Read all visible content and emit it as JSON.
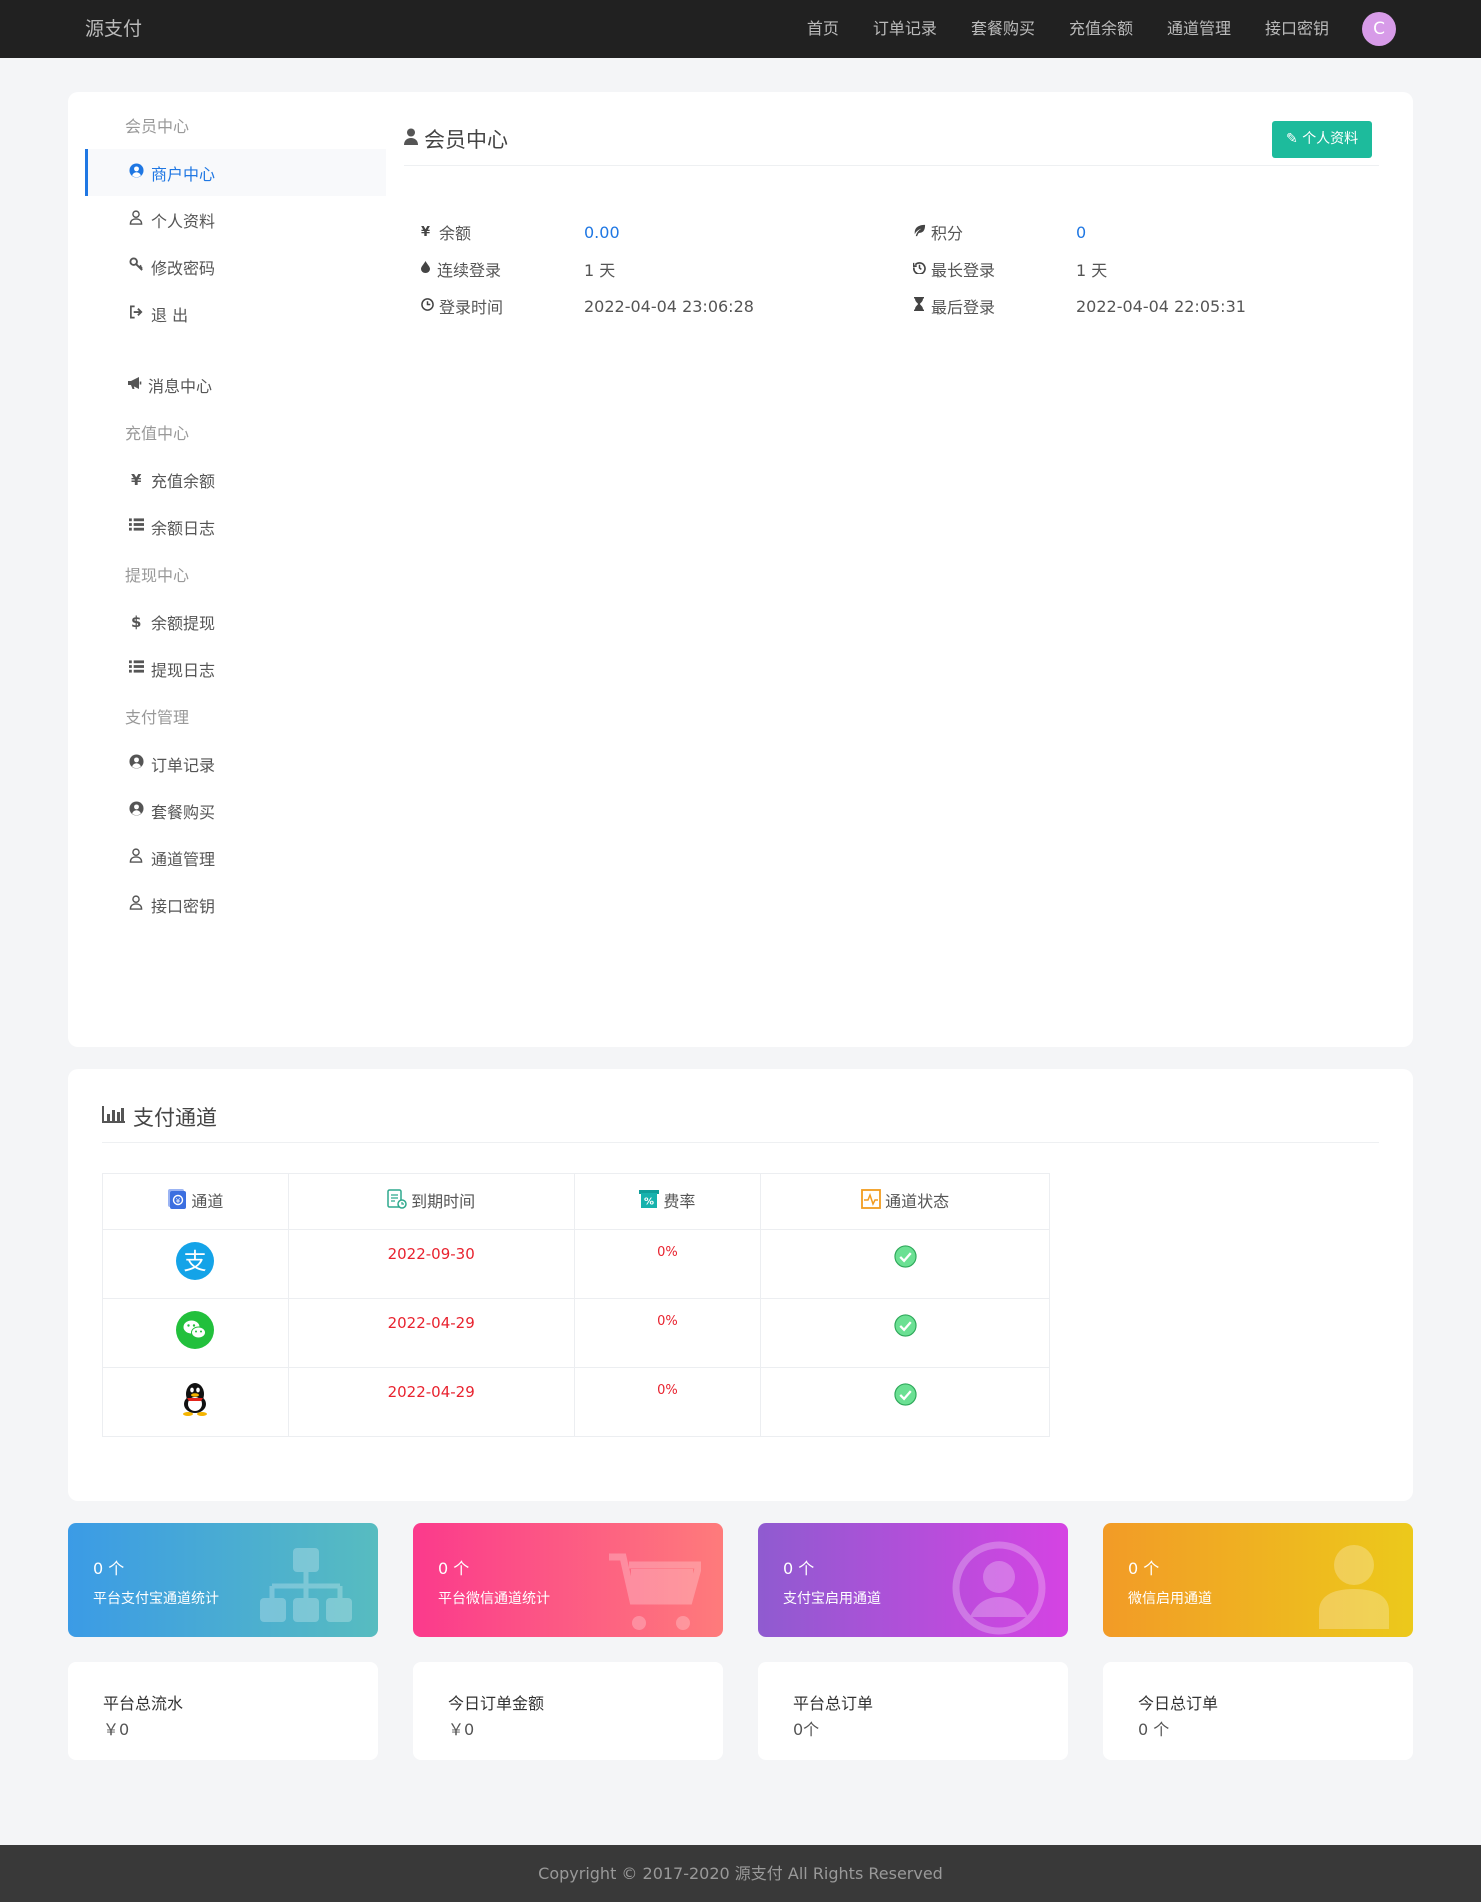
{
  "header": {
    "brand": "源支付",
    "nav": [
      "首页",
      "订单记录",
      "套餐购买",
      "充值余额",
      "通道管理",
      "接口密钥"
    ],
    "avatar_letter": "C"
  },
  "sidebar": {
    "group_member": "会员中心",
    "merchant_center": "商户中心",
    "profile": "个人资料",
    "change_password": "修改密码",
    "logout": "退 出",
    "message_center": "消息中心",
    "group_recharge": "充值中心",
    "recharge_balance": "充值余额",
    "balance_log": "余额日志",
    "group_withdraw": "提现中心",
    "withdraw": "余额提现",
    "withdraw_log": "提现日志",
    "group_payment": "支付管理",
    "orders": "订单记录",
    "packages": "套餐购买",
    "channels": "通道管理",
    "api_keys": "接口密钥"
  },
  "member": {
    "title": "会员中心",
    "profile_button": "个人资料",
    "balance_label": "余额",
    "balance_value": "0.00",
    "points_label": "积分",
    "points_value": "0",
    "streak_label": "连续登录",
    "streak_value": "1 天",
    "longest_label": "最长登录",
    "longest_value": "1 天",
    "login_time_label": "登录时间",
    "login_time_value": "2022-04-04 23:06:28",
    "last_login_label": "最后登录",
    "last_login_value": "2022-04-04 22:05:31"
  },
  "channels": {
    "title": "支付通道",
    "headers": [
      "通道",
      "到期时间",
      "费率",
      "通道状态"
    ],
    "rows": [
      {
        "icon": "alipay-icon",
        "expire": "2022-09-30",
        "rate": "0%"
      },
      {
        "icon": "wechat-icon",
        "expire": "2022-04-29",
        "rate": "0%"
      },
      {
        "icon": "qq-icon",
        "expire": "2022-04-29",
        "rate": "0%"
      }
    ]
  },
  "stats": [
    {
      "count": "0 个",
      "label": "平台支付宝通道统计",
      "colors": [
        "#3b9be6",
        "#57bcc0"
      ],
      "icon": "sitemap-icon"
    },
    {
      "count": "0 个",
      "label": "平台微信通道统计",
      "colors": [
        "#fb3a8c",
        "#fe7b7b"
      ],
      "icon": "cart-icon"
    },
    {
      "count": "0 个",
      "label": "支付宝启用通道",
      "colors": [
        "#8f5bd0",
        "#d543e3"
      ],
      "icon": "user-circle-icon"
    },
    {
      "count": "0 个",
      "label": "微信启用通道",
      "colors": [
        "#f29b27",
        "#ecc91b"
      ],
      "icon": "user-icon"
    }
  ],
  "summary": [
    {
      "title": "平台总流水",
      "value": "￥0"
    },
    {
      "title": "今日订单金额",
      "value": "￥0"
    },
    {
      "title": "平台总订单",
      "value": "0个"
    },
    {
      "title": "今日总订单",
      "value": "0 个"
    }
  ],
  "footer": "Copyright © 2017-2020 源支付 All Rights Reserved"
}
